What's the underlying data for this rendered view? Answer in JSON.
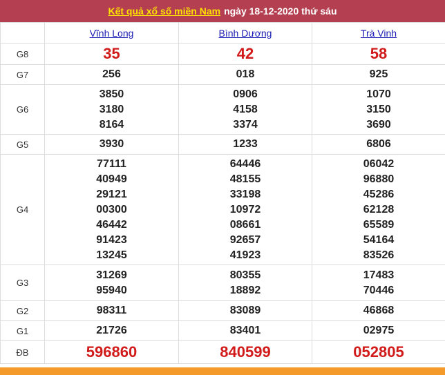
{
  "header": {
    "link_text": "Kết quả xổ số miền Nam",
    "date_text": "ngày 18-12-2020 thứ sáu"
  },
  "provinces": [
    "Vĩnh Long",
    "Bình Dương",
    "Trà Vinh"
  ],
  "prizes": [
    {
      "label": "G8",
      "values": [
        [
          "35"
        ],
        [
          "42"
        ],
        [
          "58"
        ]
      ]
    },
    {
      "label": "G7",
      "values": [
        [
          "256"
        ],
        [
          "018"
        ],
        [
          "925"
        ]
      ]
    },
    {
      "label": "G6",
      "values": [
        [
          "3850",
          "3180",
          "8164"
        ],
        [
          "0906",
          "4158",
          "3374"
        ],
        [
          "1070",
          "3150",
          "3690"
        ]
      ]
    },
    {
      "label": "G5",
      "values": [
        [
          "3930"
        ],
        [
          "1233"
        ],
        [
          "6806"
        ]
      ]
    },
    {
      "label": "G4",
      "values": [
        [
          "77111",
          "40949",
          "29121",
          "00300",
          "46442",
          "91423",
          "13245"
        ],
        [
          "64446",
          "48155",
          "33198",
          "10972",
          "08661",
          "92657",
          "41923"
        ],
        [
          "06042",
          "96880",
          "45286",
          "62128",
          "65589",
          "54164",
          "83526"
        ]
      ]
    },
    {
      "label": "G3",
      "values": [
        [
          "31269",
          "95940"
        ],
        [
          "80355",
          "18892"
        ],
        [
          "17483",
          "70446"
        ]
      ]
    },
    {
      "label": "G2",
      "values": [
        [
          "98311"
        ],
        [
          "83089"
        ],
        [
          "46868"
        ]
      ]
    },
    {
      "label": "G1",
      "values": [
        [
          "21726"
        ],
        [
          "83401"
        ],
        [
          "02975"
        ]
      ]
    },
    {
      "label": "ĐB",
      "values": [
        [
          "596860"
        ],
        [
          "840599"
        ],
        [
          "052805"
        ]
      ]
    }
  ],
  "colors": {
    "header_bg": "#b43f50",
    "header_link": "#ffe000",
    "prize_red": "#d11a1a",
    "province_link": "#1a1ab4",
    "footer_bar": "#f39a2a"
  }
}
